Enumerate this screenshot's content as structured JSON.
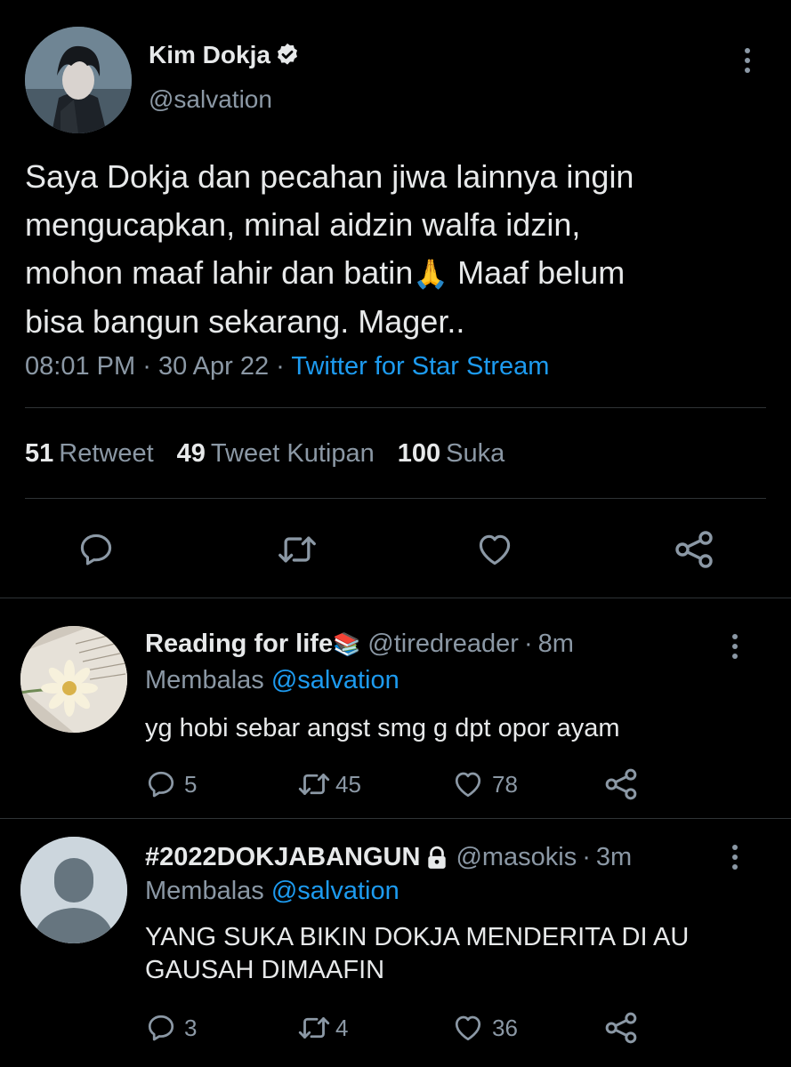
{
  "tweet": {
    "author_name": "Kim Dokja",
    "author_handle": "@salvation",
    "text_lines": [
      "Saya Dokja dan pecahan jiwa lainnya ingin",
      "mengucapkan, minal aidzin walfa idzin,",
      "mohon maaf lahir dan batin",
      "bisa bangun sekarang. Mager.."
    ],
    "text_line3_after_emoji": " Maaf belum",
    "emoji": "🙏",
    "time": "08:01 PM",
    "date": "30 Apr 22",
    "separator": "·",
    "source": "Twitter for Star Stream",
    "stats": {
      "retweets_count": "51",
      "retweets_label": "Retweet",
      "quotes_count": "49",
      "quotes_label": "Tweet Kutipan",
      "likes_count": "100",
      "likes_label": "Suka"
    },
    "icons": [
      "reply-icon",
      "retweet-icon",
      "like-icon",
      "share-icon",
      "more-icon",
      "verified-icon"
    ]
  },
  "replies": [
    {
      "name": "Reading for life",
      "name_emoji": "📚",
      "handle": "@tiredreader",
      "time": "8m",
      "replying_prefix": "Membalas",
      "replying_to": "@salvation",
      "text_lines": [
        "yg hobi sebar angst smg g dpt opor ayam"
      ],
      "reply_count": "5",
      "retweet_count": "45",
      "like_count": "78"
    },
    {
      "name": "#2022DOKJABANGUN",
      "handle": "@masokis",
      "time": "3m",
      "replying_prefix": "Membalas",
      "replying_to": "@salvation",
      "text_lines": [
        "YANG SUKA BIKIN DOKJA MENDERITA DI AU",
        "GAUSAH DIMAAFIN"
      ],
      "reply_count": "3",
      "retweet_count": "4",
      "like_count": "36"
    }
  ],
  "colors": {
    "background": "#000000",
    "text": "#e7e9ea",
    "muted": "#8b98a5",
    "link": "#1d9bf0",
    "divider": "#2f3336"
  }
}
